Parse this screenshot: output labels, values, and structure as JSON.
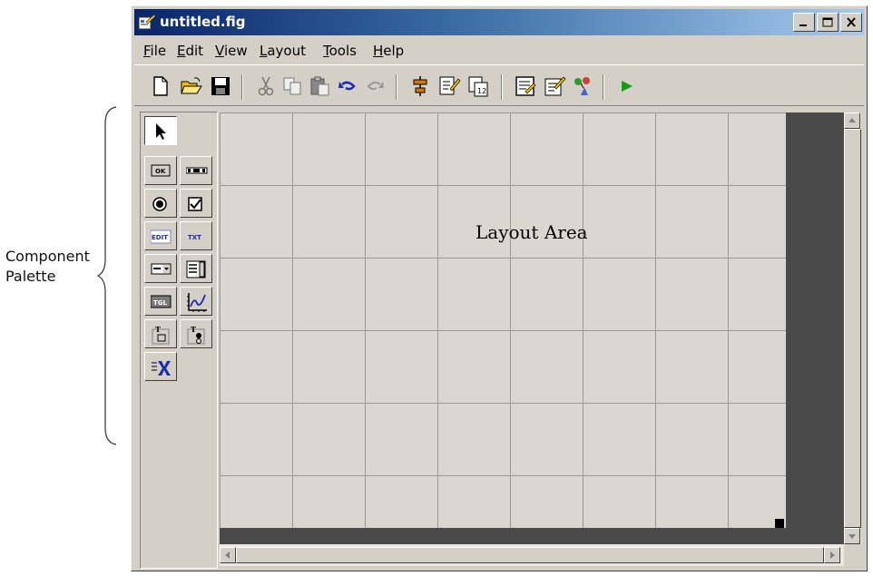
{
  "annotation": {
    "line1": "Component",
    "line2": "Palette"
  },
  "window": {
    "title": "untitled.fig"
  },
  "menus": [
    "File",
    "Edit",
    "View",
    "Layout",
    "Tools",
    "Help"
  ],
  "toolbar_icons": [
    "new-icon",
    "open-icon",
    "save-icon",
    "cut-icon",
    "copy-icon",
    "paste-icon",
    "undo-icon",
    "redo-icon",
    "align-icon",
    "menu-editor-icon",
    "tab-order-icon",
    "mfile-editor-icon",
    "property-inspector-icon",
    "object-browser-icon",
    "run-icon"
  ],
  "palette": {
    "items": [
      "select",
      "push-button",
      "slider",
      "radio-button",
      "checkbox",
      "edit-text",
      "static-text",
      "popup-menu",
      "listbox",
      "toggle-button",
      "axes",
      "panel",
      "button-group",
      "activex-control"
    ],
    "labels": {
      "ok": "OK",
      "edit": "EDIT",
      "txt": "TXT",
      "tgl": "TGL"
    }
  },
  "layout": {
    "label": "Layout Area"
  },
  "colors": {
    "titlebar_start": "#0a246a",
    "titlebar_end": "#a6caf0",
    "face": "#d4d0c8",
    "grid_bg": "#d9d7d0"
  }
}
